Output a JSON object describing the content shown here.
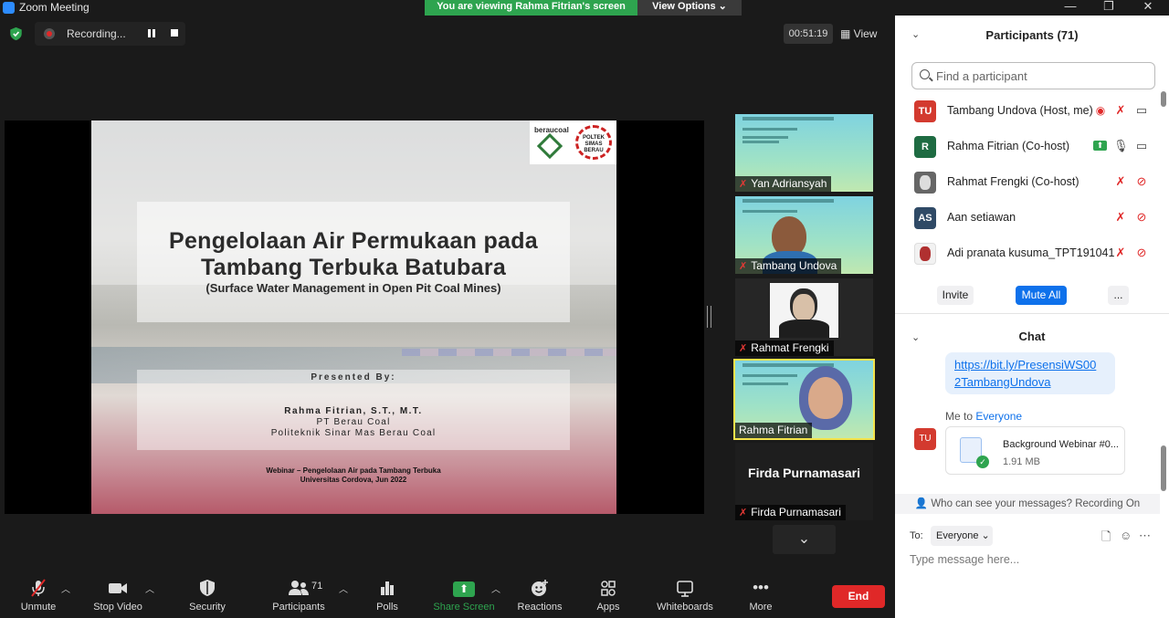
{
  "window": {
    "title": "Zoom Meeting",
    "banner": "You are viewing Rahma Fitrian's screen",
    "view_options": "View Options ⌄",
    "minimize": "—",
    "maximize": "❐",
    "close": "✕"
  },
  "meeting_bar": {
    "recording_label": "Recording...",
    "timer": "00:51:19",
    "view_label": "View"
  },
  "slide": {
    "logo_berau": "beraucoal",
    "logo_poltek": "POLTEK SIMAS BERAU",
    "title_line1": "Pengelolaan Air Permukaan pada",
    "title_line2": "Tambang Terbuka Batubara",
    "subtitle": "(Surface Water Management in Open Pit Coal Mines)",
    "presented_by": "Presented By:",
    "presenter_name": "Rahma Fitrian, S.T., M.T.",
    "presenter_org1": "PT Berau Coal",
    "presenter_org2": "Politeknik Sinar Mas Berau Coal",
    "webinar_line1": "Webinar – Pengelolaan Air pada Tambang Terbuka",
    "webinar_line2": "Universitas Cordova, Jun 2022"
  },
  "video_tiles": [
    {
      "name": "Yan Adriansyah",
      "muted": true
    },
    {
      "name": "Tambang Undova",
      "muted": true
    },
    {
      "name": "Rahmat Frengki",
      "muted": true
    },
    {
      "name": "Rahma Fitrian",
      "muted": false
    },
    {
      "name": "Firda Purnamasari",
      "display_name": "Firda Purnamasari",
      "muted": true
    }
  ],
  "toolbar": {
    "unmute": "Unmute",
    "stop_video": "Stop Video",
    "security": "Security",
    "participants": "Participants",
    "participants_count": "71",
    "polls": "Polls",
    "share_screen": "Share Screen",
    "reactions": "Reactions",
    "apps": "Apps",
    "whiteboards": "Whiteboards",
    "more": "More",
    "end": "End"
  },
  "participants_panel": {
    "title": "Participants (71)",
    "search_placeholder": "Find a participant",
    "list": [
      {
        "initials": "TU",
        "name": "Tambang Undova (Host, me)",
        "avatar_color": "#d33a2f"
      },
      {
        "initials": "R",
        "name": "Rahma Fitrian (Co-host)",
        "avatar_color": "#1e6b42"
      },
      {
        "initials": "",
        "name": "Rahmat Frengki (Co-host)",
        "avatar_color": "#666666"
      },
      {
        "initials": "AS",
        "name": "Aan setiawan",
        "avatar_color": "#2f4a66"
      },
      {
        "initials": "",
        "name": "Adi pranata kusuma_TPT191041",
        "avatar_color": "#b03030"
      }
    ],
    "invite": "Invite",
    "mute_all": "Mute All",
    "more": "..."
  },
  "chat": {
    "title": "Chat",
    "link_line1": "https://bit.ly/PresensiWS00",
    "link_line2": "2TambangUndova",
    "me_to": "Me to",
    "me_to_who": "Everyone",
    "sender_initials": "TU",
    "file_name": "Background Webinar #0...",
    "file_size": "1.91 MB",
    "who_can_see": "Who can see your messages? Recording On",
    "to_label": "To:",
    "to_value": "Everyone ⌄",
    "input_placeholder": "Type message here..."
  },
  "colors": {
    "share_green": "#2ea44f",
    "end_red": "#e02828",
    "accent_blue": "#0e71eb",
    "active_speaker": "#f3e34b"
  }
}
